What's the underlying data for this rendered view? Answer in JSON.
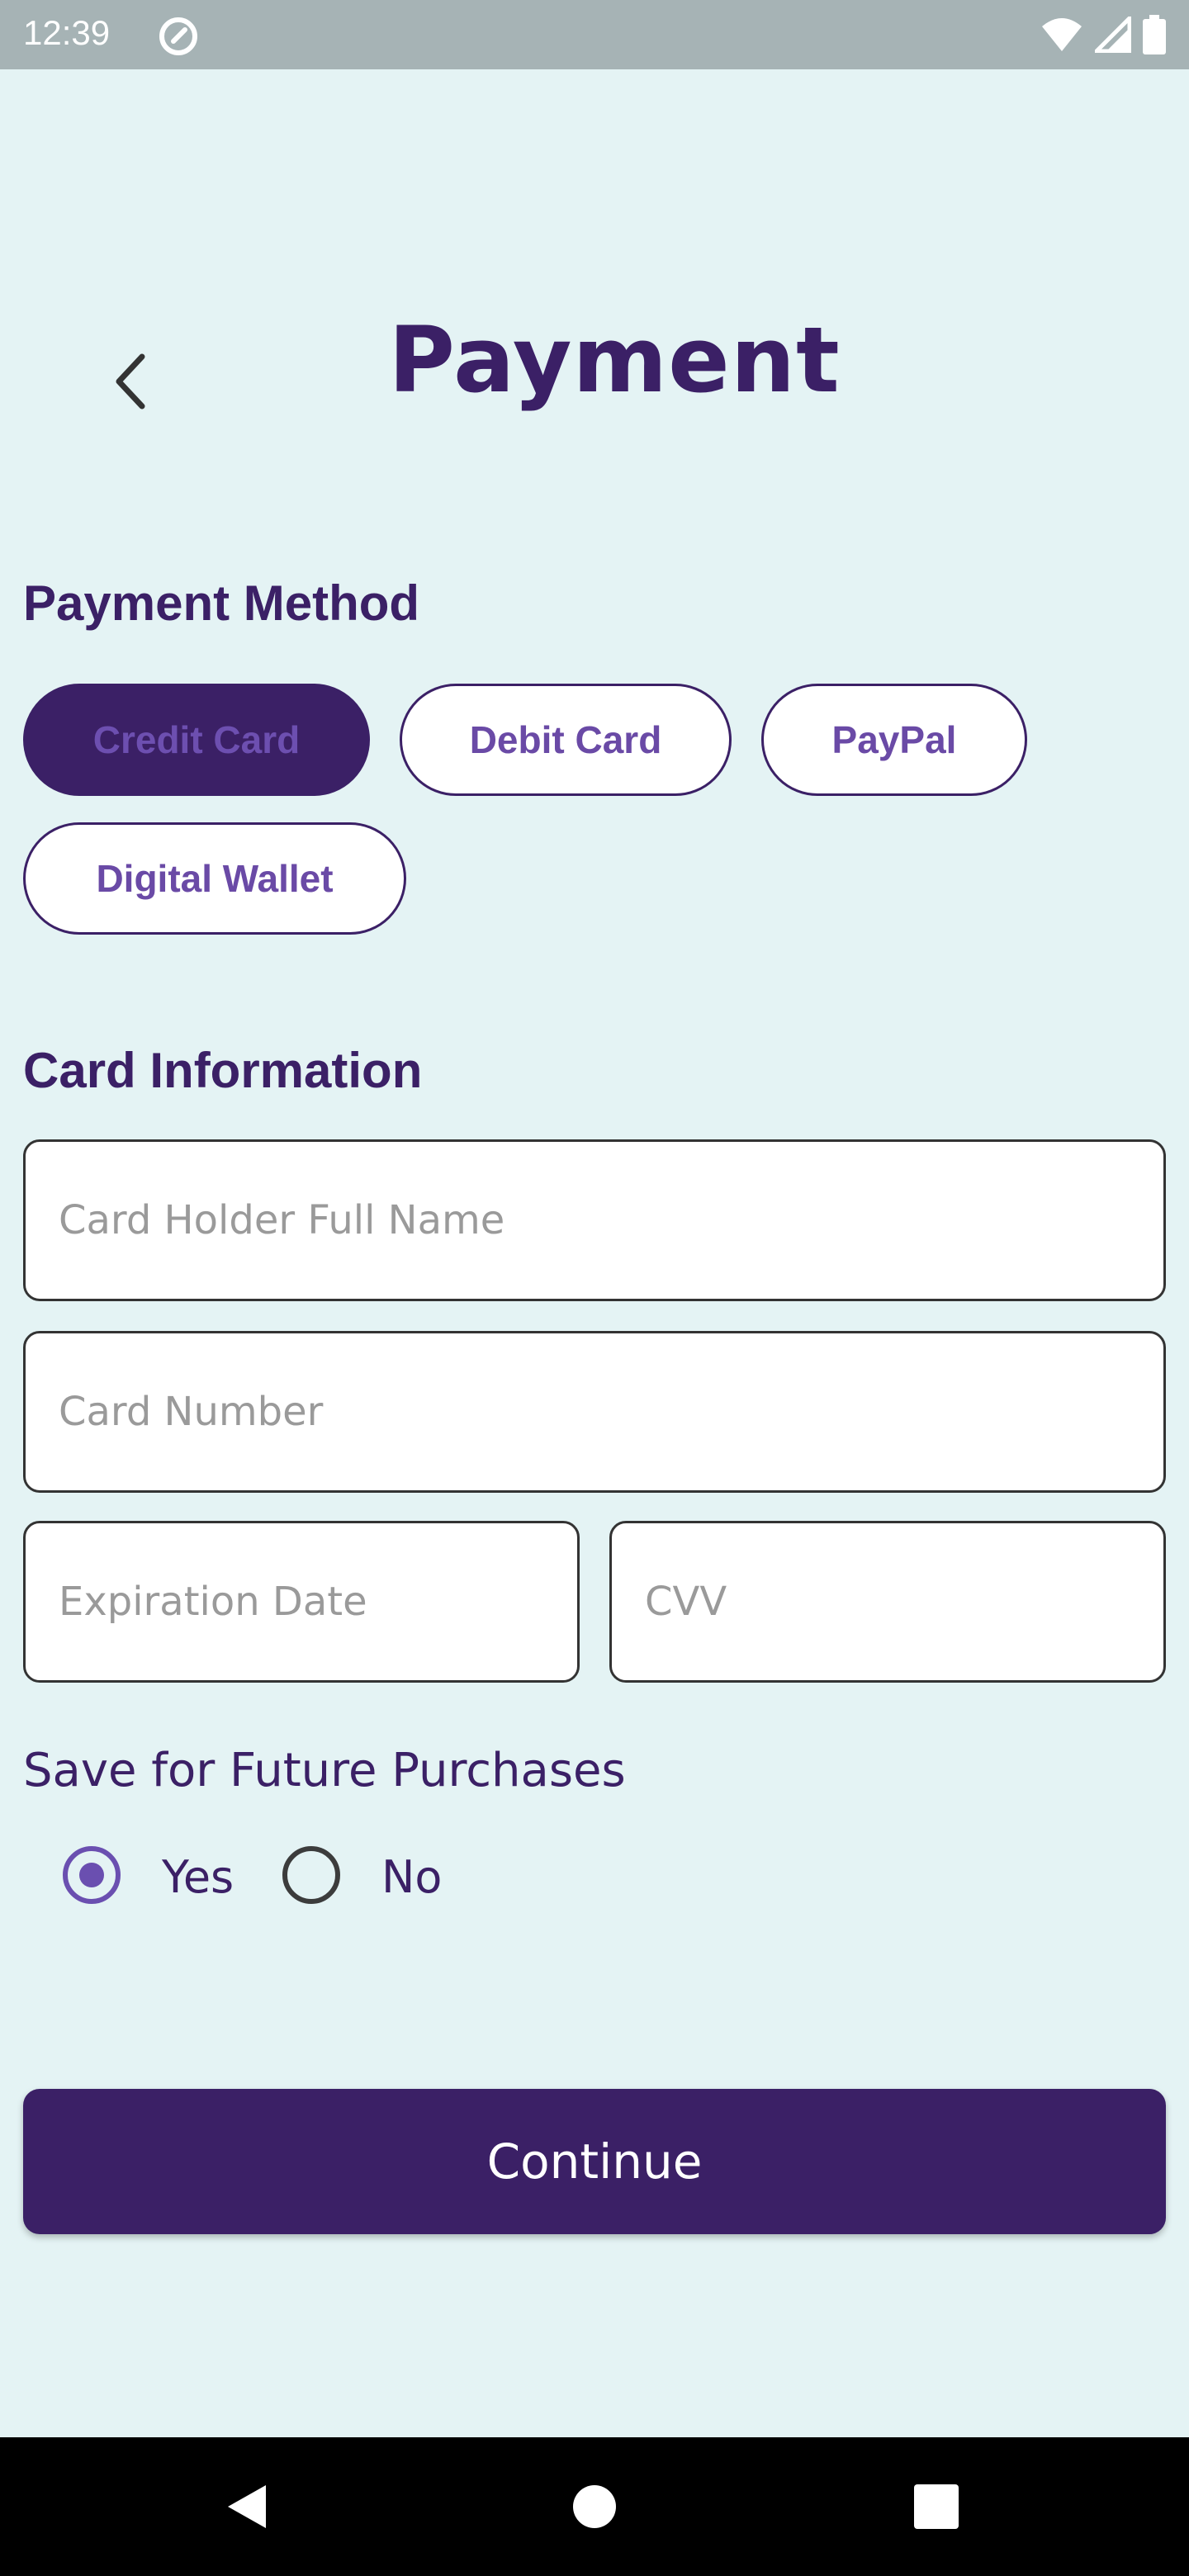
{
  "status_bar": {
    "time": "12:39",
    "app_icon": "at-sign-icon",
    "icons": [
      "wifi-icon",
      "signal-icon",
      "battery-icon"
    ]
  },
  "header": {
    "title": "Payment",
    "back_icon": "chevron-left-icon"
  },
  "payment_method": {
    "title": "Payment Method",
    "options": [
      {
        "label": "Credit Card",
        "selected": true
      },
      {
        "label": "Debit Card",
        "selected": false
      },
      {
        "label": "PayPal",
        "selected": false
      },
      {
        "label": "Digital Wallet",
        "selected": false
      }
    ]
  },
  "card_info": {
    "title": "Card Information",
    "holder_placeholder": "Card Holder Full Name",
    "holder_value": "",
    "number_placeholder": "Card Number",
    "number_value": "",
    "expiry_placeholder": "Expiration Date",
    "expiry_value": "",
    "cvv_placeholder": "CVV",
    "cvv_value": ""
  },
  "save_future": {
    "label": "Save for Future Purchases",
    "options": [
      {
        "label": "Yes",
        "checked": true
      },
      {
        "label": "No",
        "checked": false
      }
    ]
  },
  "continue_button": {
    "label": "Continue"
  },
  "colors": {
    "background": "#e4f3f4",
    "primary": "#3b2066",
    "accent": "#6a4fb0",
    "status_bar": "#a6b3b5",
    "nav_bar": "#000000"
  },
  "nav_bar": {
    "buttons": [
      "back-triangle-icon",
      "home-circle-icon",
      "recents-square-icon"
    ]
  }
}
